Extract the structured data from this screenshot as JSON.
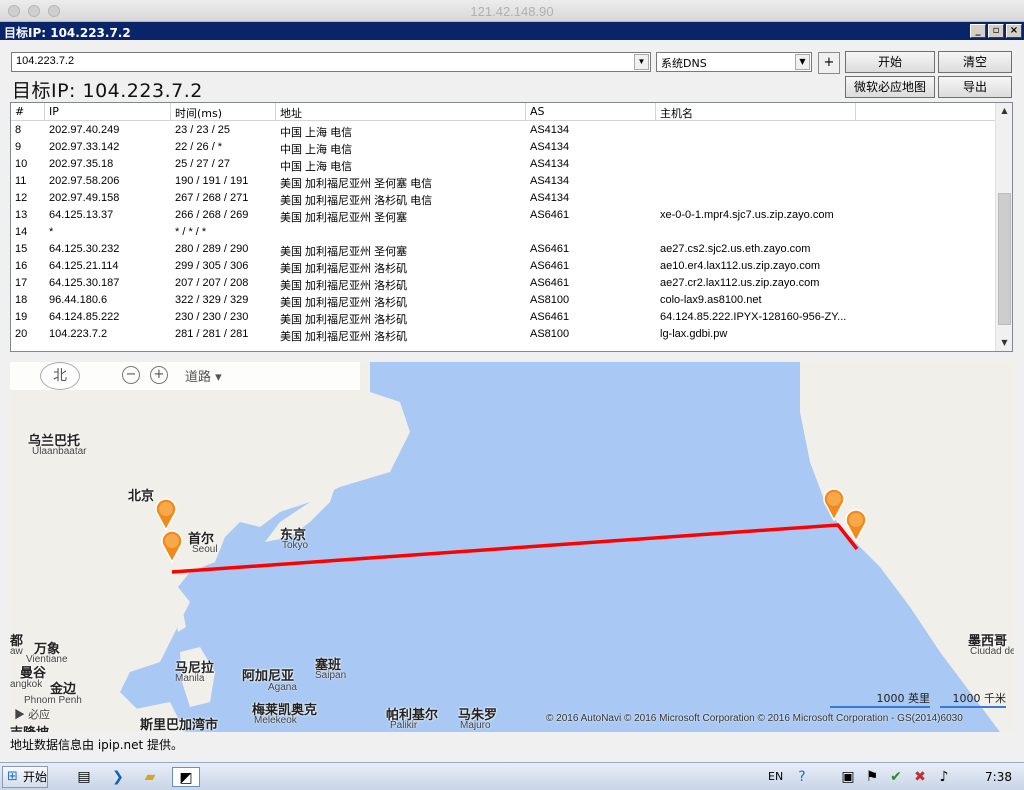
{
  "mac": {
    "title": "121.42.148.90"
  },
  "window": {
    "title": "目标IP: 104.223.7.2",
    "btn_min": "_",
    "btn_max": "▫",
    "btn_close": "×"
  },
  "toolbar": {
    "target_value": "104.223.7.2",
    "dns_value": "系统DNS",
    "plus_label": "+",
    "start_label": "开始",
    "clear_label": "清空",
    "map_label": "微软必应地图",
    "export_label": "导出"
  },
  "heading": "目标IP: 104.223.7.2",
  "table": {
    "columns": [
      "#",
      "IP",
      "时间(ms)",
      "地址",
      "AS",
      "主机名",
      ""
    ],
    "rows": [
      [
        "8",
        "202.97.40.249",
        "23 / 23 / 25",
        "中国 上海 电信",
        "AS4134",
        ""
      ],
      [
        "9",
        "202.97.33.142",
        "22 / 26 / *",
        "中国 上海 电信",
        "AS4134",
        ""
      ],
      [
        "10",
        "202.97.35.18",
        "25 / 27 / 27",
        "中国 上海 电信",
        "AS4134",
        ""
      ],
      [
        "11",
        "202.97.58.206",
        "190 / 191 / 191",
        "美国 加利福尼亚州 圣何塞 电信",
        "AS4134",
        ""
      ],
      [
        "12",
        "202.97.49.158",
        "267 / 268 / 271",
        "美国 加利福尼亚州 洛杉矶 电信",
        "AS4134",
        ""
      ],
      [
        "13",
        "64.125.13.37",
        "266 / 268 / 269",
        "美国 加利福尼亚州 圣何塞",
        "AS6461",
        "xe-0-0-1.mpr4.sjc7.us.zip.zayo.com"
      ],
      [
        "14",
        "*",
        "* / * / *",
        "",
        "",
        ""
      ],
      [
        "15",
        "64.125.30.232",
        "280 / 289 / 290",
        "美国 加利福尼亚州 圣何塞",
        "AS6461",
        "ae27.cs2.sjc2.us.eth.zayo.com"
      ],
      [
        "16",
        "64.125.21.114",
        "299 / 305 / 306",
        "美国 加利福尼亚州 洛杉矶",
        "AS6461",
        "ae10.er4.lax112.us.zip.zayo.com"
      ],
      [
        "17",
        "64.125.30.187",
        "207 / 207 / 208",
        "美国 加利福尼亚州 洛杉矶",
        "AS6461",
        "ae27.cr2.lax112.us.zip.zayo.com"
      ],
      [
        "18",
        "96.44.180.6",
        "322 / 329 / 329",
        "美国 加利福尼亚州 洛杉矶",
        "AS8100",
        "colo-lax9.as8100.net"
      ],
      [
        "19",
        "64.124.85.222",
        "230 / 230 / 230",
        "美国 加利福尼亚州 洛杉矶",
        "AS6461",
        "64.124.85.222.IPYX-128160-956-ZY..."
      ],
      [
        "20",
        "104.223.7.2",
        "281 / 281 / 281",
        "美国 加利福尼亚州 洛杉矶",
        "AS8100",
        "lg-lax.gdbi.pw"
      ]
    ]
  },
  "map": {
    "controls": {
      "north": "北",
      "zoom_out": "−",
      "zoom_in": "+",
      "mode": "道路 ▾"
    },
    "labels": {
      "ulaanbaatar": "乌兰巴托",
      "ulaanbaatar_en": "Ulaanbaatar",
      "beijing": "北京",
      "seoul": "首尔",
      "seoul_en": "Seoul",
      "tokyo": "东京",
      "tokyo_en": "Tokyo",
      "du": "都",
      "du_en": "aw",
      "vientiane": "万象",
      "vientiane_en": "Vientiane",
      "bangkok": "曼谷",
      "bangkok_en": "angkok",
      "phnompenh": "金边",
      "phnompenh_en": "Phnom Penh",
      "manila": "马尼拉",
      "manila_en": "Manila",
      "agana": "阿加尼亚",
      "agana_en": "Agana",
      "saipan": "塞班",
      "saipan_en": "Saipan",
      "melekeok": "梅莱凯奥克",
      "melekeok_en": "Melekeok",
      "palikir": "帕利基尔",
      "palikir_en": "Palikir",
      "majuro": "马朱罗",
      "majuro_en": "Majuro",
      "begawan": "斯里巴加湾市",
      "kuala": "吉隆坡",
      "mexico": "墨西哥",
      "mexico_en": "Ciudad de"
    },
    "bing": "必应",
    "scale_mi": "1000 英里",
    "scale_km": "1000 千米",
    "copyright": "© 2016 AutoNavi   © 2016 Microsoft Corporation   © 2016 Microsoft Corporation - GS(2014)6030",
    "route_color": "#ff0000",
    "pin_color": "#f08a1c"
  },
  "footer": "地址数据信息由 ipip.net 提供。",
  "taskbar": {
    "start_label": "开始",
    "lang": "EN",
    "time": "7:38"
  }
}
